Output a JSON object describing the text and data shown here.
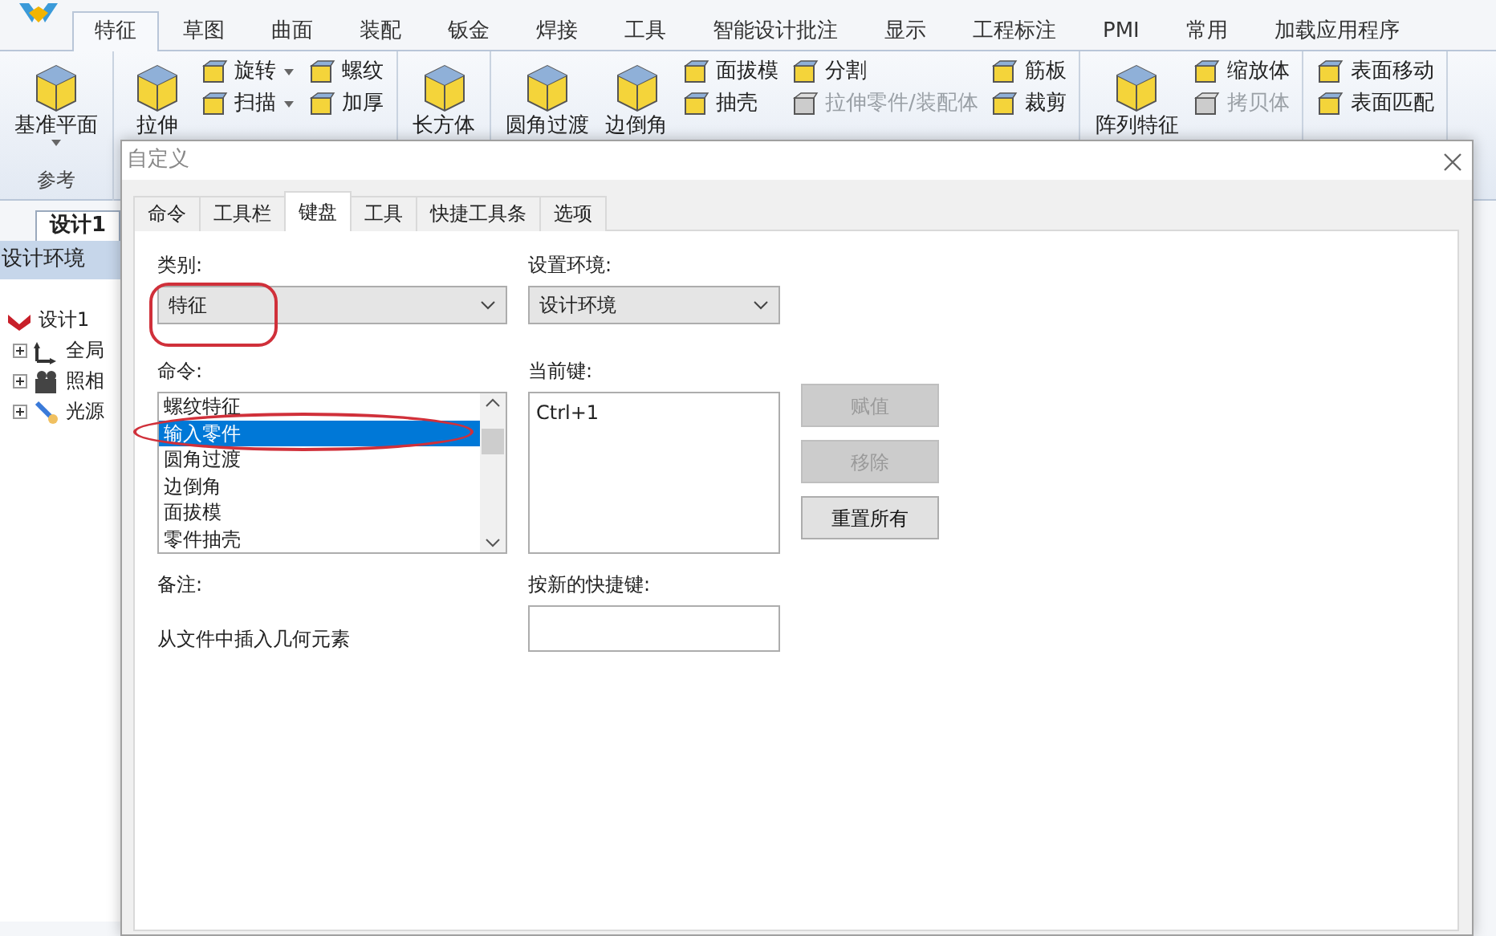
{
  "app_tabs": [
    {
      "label": "特征",
      "selected": true
    },
    {
      "label": "草图",
      "selected": false
    },
    {
      "label": "曲面",
      "selected": false
    },
    {
      "label": "装配",
      "selected": false
    },
    {
      "label": "钣金",
      "selected": false
    },
    {
      "label": "焊接",
      "selected": false
    },
    {
      "label": "工具",
      "selected": false
    },
    {
      "label": "智能设计批注",
      "selected": false
    },
    {
      "label": "显示",
      "selected": false
    },
    {
      "label": "工程标注",
      "selected": false
    },
    {
      "label": "PMI",
      "selected": false
    },
    {
      "label": "常用",
      "selected": false
    },
    {
      "label": "加载应用程序",
      "selected": false
    }
  ],
  "ribbon": {
    "groups": [
      {
        "label": "参考",
        "items": [
          {
            "kind": "large",
            "label": "基准平面",
            "dropdown": true
          }
        ]
      },
      {
        "items": [
          {
            "kind": "large",
            "label": "拉伸",
            "dropdown": false
          },
          {
            "kind": "stack",
            "items": [
              {
                "label": "旋转",
                "dropdown": true,
                "disabled": false
              },
              {
                "label": "扫描",
                "dropdown": true,
                "disabled": false
              }
            ]
          },
          {
            "kind": "stack",
            "items": [
              {
                "label": "螺纹",
                "dropdown": false,
                "disabled": false
              },
              {
                "label": "加厚",
                "dropdown": false,
                "disabled": false
              }
            ]
          }
        ]
      },
      {
        "items": [
          {
            "kind": "large",
            "label": "长方体",
            "dropdown": false
          }
        ]
      },
      {
        "items": [
          {
            "kind": "large",
            "label": "圆角过渡",
            "dropdown": false
          },
          {
            "kind": "large",
            "label": "边倒角",
            "dropdown": false
          },
          {
            "kind": "stack",
            "items": [
              {
                "label": "面拔模",
                "dropdown": false,
                "disabled": false
              },
              {
                "label": "抽壳",
                "dropdown": false,
                "disabled": false
              }
            ]
          },
          {
            "kind": "stack",
            "items": [
              {
                "label": "分割",
                "dropdown": false,
                "disabled": false
              },
              {
                "label": "拉伸零件/装配体",
                "dropdown": false,
                "disabled": true
              }
            ]
          },
          {
            "kind": "stack",
            "items": [
              {
                "label": "筋板",
                "dropdown": false,
                "disabled": false
              },
              {
                "label": "裁剪",
                "dropdown": false,
                "disabled": false
              }
            ]
          }
        ]
      },
      {
        "items": [
          {
            "kind": "large",
            "label": "阵列特征",
            "dropdown": false
          },
          {
            "kind": "stack",
            "items": [
              {
                "label": "缩放体",
                "dropdown": false,
                "disabled": false
              },
              {
                "label": "拷贝体",
                "dropdown": false,
                "disabled": true
              }
            ]
          }
        ]
      },
      {
        "items": [
          {
            "kind": "stack",
            "items": [
              {
                "label": "表面移动",
                "dropdown": false,
                "disabled": false
              },
              {
                "label": "表面匹配",
                "dropdown": false,
                "disabled": false
              }
            ]
          }
        ]
      }
    ]
  },
  "left_panel": {
    "doc_tab": "设计1",
    "header": "设计环境",
    "tree": [
      {
        "label": "设计1",
        "children": [
          {
            "label": "全局",
            "expanded": false
          },
          {
            "label": "照相",
            "expanded": false
          },
          {
            "label": "光源",
            "expanded": false
          }
        ]
      }
    ]
  },
  "dialog": {
    "title": "自定义",
    "tabs": [
      {
        "label": "命令",
        "selected": false
      },
      {
        "label": "工具栏",
        "selected": false
      },
      {
        "label": "键盘",
        "selected": true
      },
      {
        "label": "工具",
        "selected": false
      },
      {
        "label": "快捷工具条",
        "selected": false
      },
      {
        "label": "选项",
        "selected": false
      }
    ],
    "category": {
      "label": "类别:",
      "value": "特征",
      "circled": true
    },
    "environment": {
      "label": "设置环境:",
      "value": "设计环境"
    },
    "commands": {
      "label": "命令:",
      "items": [
        {
          "label": "螺纹特征",
          "selected": false,
          "circled": false
        },
        {
          "label": "输入零件",
          "selected": true,
          "circled": true
        },
        {
          "label": "圆角过渡",
          "selected": false,
          "circled": false
        },
        {
          "label": "边倒角",
          "selected": false,
          "circled": false
        },
        {
          "label": "面拔模",
          "selected": false,
          "circled": false
        },
        {
          "label": "零件抽壳",
          "selected": false,
          "circled": false
        }
      ]
    },
    "current_keys": {
      "label": "当前键:",
      "keys": [
        "Ctrl+1"
      ]
    },
    "buttons": [
      {
        "label": "赋值",
        "disabled": true
      },
      {
        "label": "移除",
        "disabled": true
      },
      {
        "label": "重置所有",
        "disabled": false
      }
    ],
    "note": {
      "label": "备注:",
      "text": "从文件中插入几何元素"
    },
    "new_shortcut": {
      "label": "按新的快捷键:"
    }
  }
}
